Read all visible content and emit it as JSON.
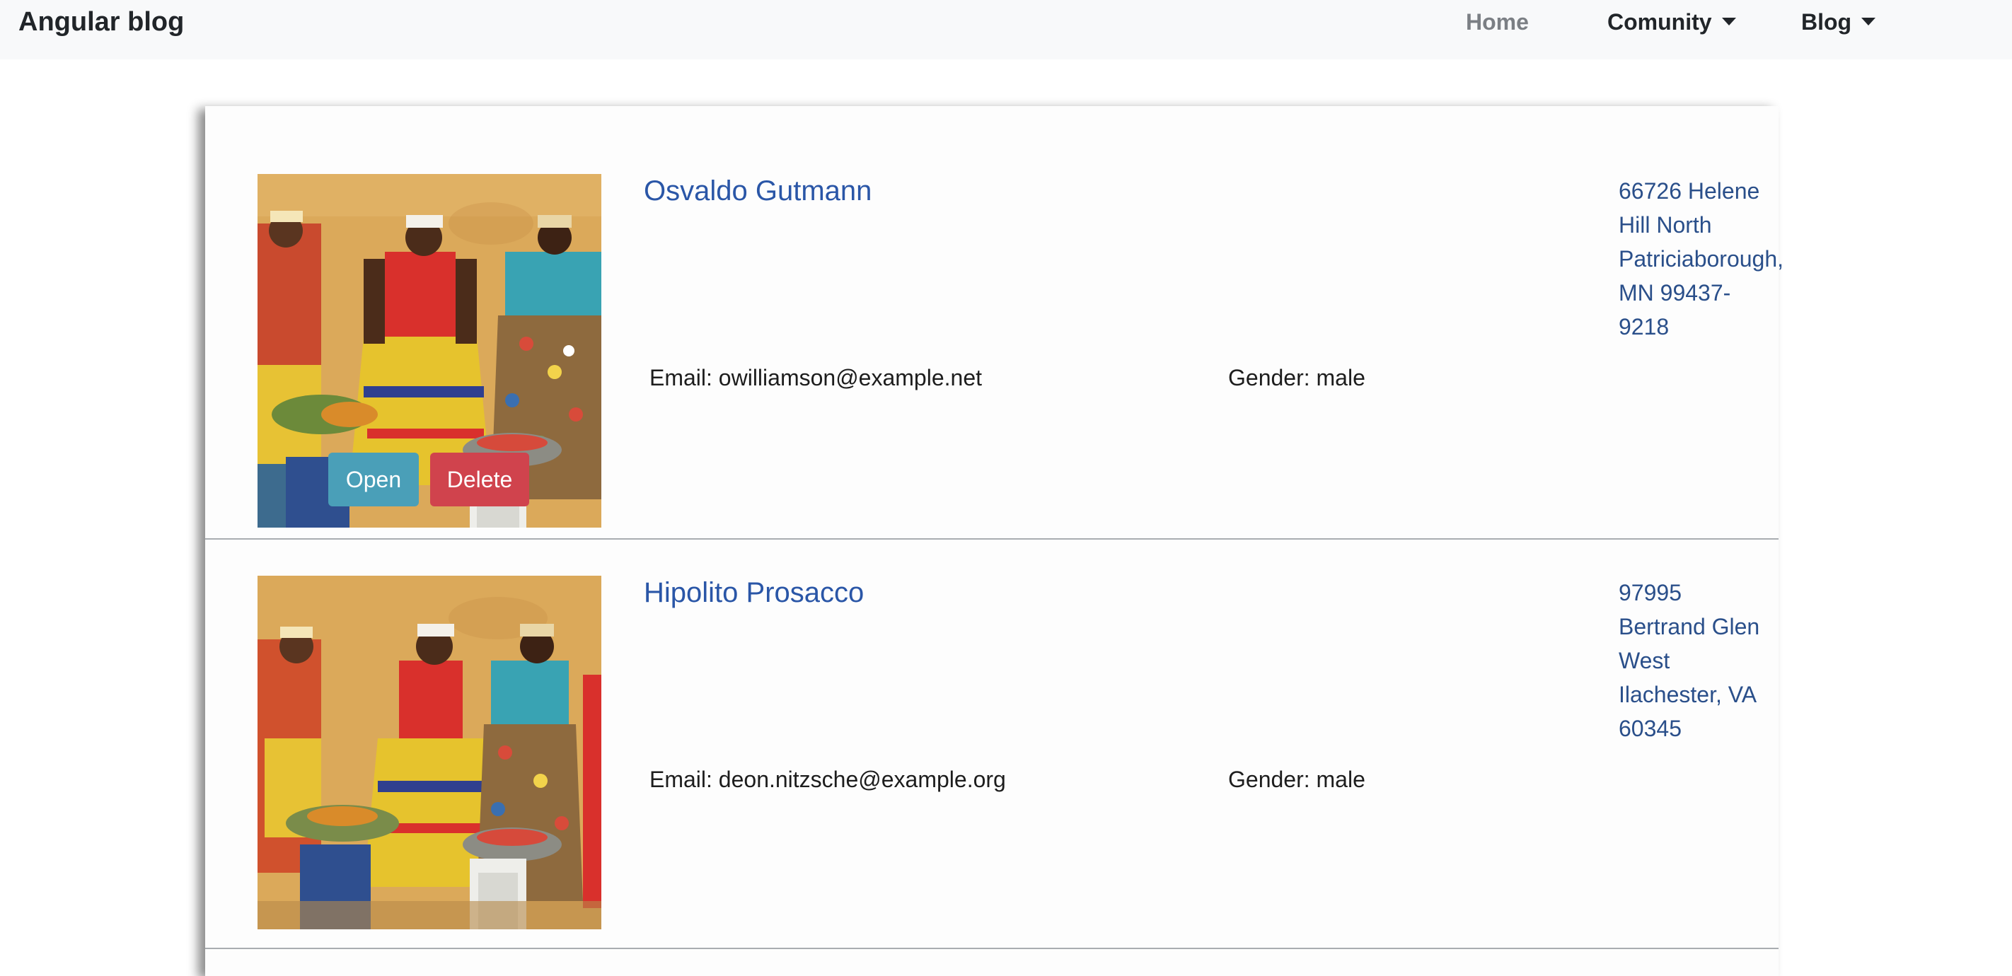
{
  "navbar": {
    "brand": "Angular blog",
    "home": "Home",
    "comunity": "Comunity",
    "blog": "Blog"
  },
  "buttons": {
    "open": "Open",
    "delete": "Delete"
  },
  "users": [
    {
      "name": "Osvaldo Gutmann",
      "email": "Email: owilliamson@example.net",
      "gender": "Gender: male",
      "address_lines": [
        "66726 Helene",
        "Hill North",
        "Patriciaborough,",
        "MN 99437-",
        "9218"
      ]
    },
    {
      "name": "Hipolito Prosacco",
      "email": "Email: deon.nitzsche@example.org",
      "gender": "Gender: male",
      "address_lines": [
        "97995",
        "Bertrand Glen",
        "West",
        "Ilachester, VA",
        "60345"
      ]
    }
  ],
  "colors": {
    "navbar_bg": "#f8f9fa",
    "name_link": "#2a56a7",
    "address_text": "#2a4f8a",
    "open_button": "#4a9fb8",
    "delete_button": "#d0434d"
  }
}
